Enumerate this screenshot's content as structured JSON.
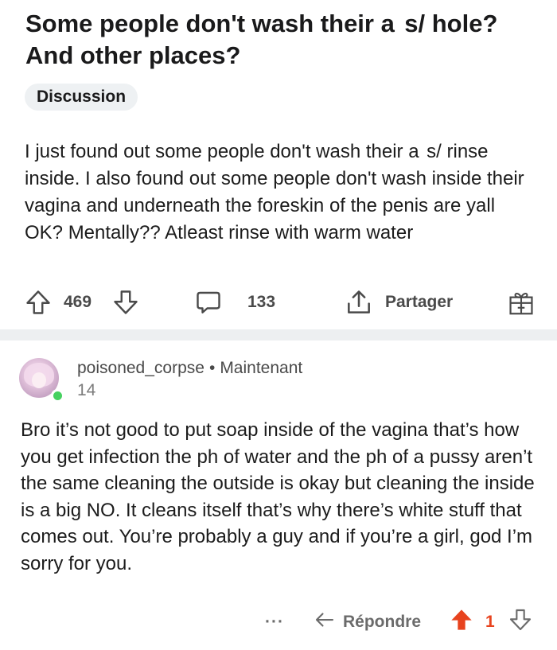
{
  "post": {
    "title": "Some people don't wash their a  s/ hole? And other places?",
    "flair": "Discussion",
    "body": "I just found out some people don't wash their a  s/ rinse inside. I also found out some people don't wash inside their vagina and underneath the foreskin of the penis are yall OK? Mentally?? Atleast rinse with warm water",
    "upvotes": "469",
    "comments": "133",
    "share_label": "Partager"
  },
  "comment": {
    "username": "poisoned_corpse",
    "separator": "•",
    "time": "Maintenant",
    "karma": "14",
    "text": "Bro it’s not good to put soap inside of the vagina that’s how you get infection the ph of water and the ph of a pussy aren’t the same cleaning the outside is okay but cleaning the inside is a big NO. It cleans itself that’s why there’s white stuff that comes out. You’re probably a guy and if you’re a girl, god I’m sorry for you.",
    "more": "···",
    "reply_label": "Répondre",
    "score": "1"
  },
  "colors": {
    "upvote_active": "#e8431e",
    "online": "#46d160",
    "divider": "#edeff1",
    "flair_bg": "#eef1f3"
  },
  "icons": [
    "upvote-icon",
    "downvote-icon",
    "comment-icon",
    "share-icon",
    "award-icon",
    "more-icon",
    "reply-icon"
  ]
}
